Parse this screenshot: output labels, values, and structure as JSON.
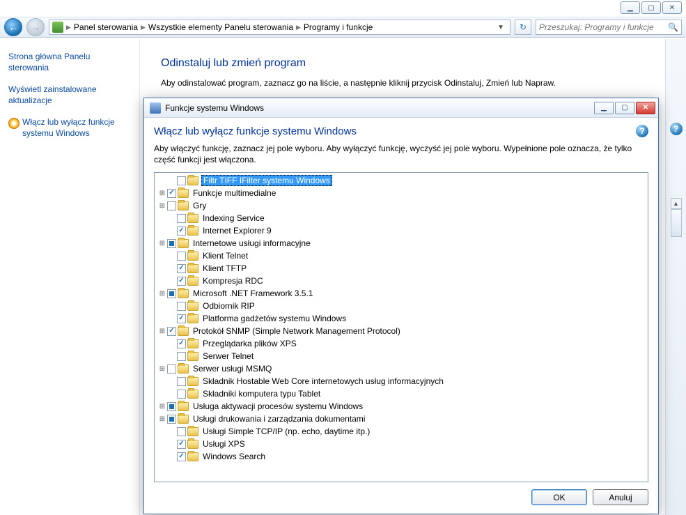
{
  "window_controls": {
    "min": "▁",
    "max": "▢",
    "close": "✕"
  },
  "breadcrumb": {
    "p1": "Panel sterowania",
    "p2": "Wszystkie elementy Panelu sterowania",
    "p3": "Programy i funkcje"
  },
  "search": {
    "placeholder": "Przeszukaj: Programy i funkcje"
  },
  "sidebar": {
    "home": "Strona główna Panelu sterowania",
    "updates": "Wyświetl zainstalowane aktualizacje",
    "features": "Włącz lub wyłącz funkcje systemu Windows"
  },
  "main": {
    "heading": "Odinstaluj lub zmień program",
    "desc": "Aby odinstalować program, zaznacz go na liście, a następnie kliknij przycisk Odinstaluj, Zmień lub Napraw."
  },
  "dialog": {
    "title": "Funkcje systemu Windows",
    "heading": "Włącz lub wyłącz funkcje systemu Windows",
    "desc": "Aby włączyć funkcję, zaznacz jej pole wyboru. Aby wyłączyć funkcję, wyczyść jej pole wyboru. Wypełnione pole oznacza, że tylko część funkcji jest włączona.",
    "ok": "OK",
    "cancel": "Anuluj",
    "items": [
      {
        "label": "Filtr TIFF IFilter systemu Windows",
        "exp": "none",
        "state": "unchecked",
        "indent": 1,
        "selected": true
      },
      {
        "label": "Funkcje multimedialne",
        "exp": "plus",
        "state": "checked",
        "indent": 0
      },
      {
        "label": "Gry",
        "exp": "plus",
        "state": "unchecked",
        "indent": 0
      },
      {
        "label": "Indexing Service",
        "exp": "none",
        "state": "unchecked",
        "indent": 1
      },
      {
        "label": "Internet Explorer 9",
        "exp": "none",
        "state": "checked",
        "indent": 1
      },
      {
        "label": "Internetowe usługi informacyjne",
        "exp": "plus",
        "state": "partial",
        "indent": 0
      },
      {
        "label": "Klient Telnet",
        "exp": "none",
        "state": "unchecked",
        "indent": 1
      },
      {
        "label": "Klient TFTP",
        "exp": "none",
        "state": "checked",
        "indent": 1
      },
      {
        "label": "Kompresja RDC",
        "exp": "none",
        "state": "checked",
        "indent": 1
      },
      {
        "label": "Microsoft .NET Framework 3.5.1",
        "exp": "plus",
        "state": "partial",
        "indent": 0
      },
      {
        "label": "Odbiornik RIP",
        "exp": "none",
        "state": "unchecked",
        "indent": 1
      },
      {
        "label": "Platforma gadżetów systemu Windows",
        "exp": "none",
        "state": "checked",
        "indent": 1
      },
      {
        "label": "Protokół SNMP (Simple Network Management Protocol)",
        "exp": "plus",
        "state": "checked",
        "indent": 0
      },
      {
        "label": "Przeglądarka plików XPS",
        "exp": "none",
        "state": "checked",
        "indent": 1
      },
      {
        "label": "Serwer Telnet",
        "exp": "none",
        "state": "unchecked",
        "indent": 1
      },
      {
        "label": "Serwer usługi MSMQ",
        "exp": "plus",
        "state": "unchecked",
        "indent": 0
      },
      {
        "label": "Składnik Hostable Web Core internetowych usług informacyjnych",
        "exp": "none",
        "state": "unchecked",
        "indent": 1
      },
      {
        "label": "Składniki komputera typu Tablet",
        "exp": "none",
        "state": "unchecked",
        "indent": 1
      },
      {
        "label": "Usługa aktywacji procesów systemu Windows",
        "exp": "plus",
        "state": "partial",
        "indent": 0
      },
      {
        "label": "Usługi drukowania i zarządzania dokumentami",
        "exp": "plus",
        "state": "partial",
        "indent": 0
      },
      {
        "label": "Usługi Simple TCP/IP (np. echo, daytime itp.)",
        "exp": "none",
        "state": "unchecked",
        "indent": 1
      },
      {
        "label": "Usługi XPS",
        "exp": "none",
        "state": "checked",
        "indent": 1
      },
      {
        "label": "Windows Search",
        "exp": "none",
        "state": "checked",
        "indent": 1
      }
    ]
  }
}
